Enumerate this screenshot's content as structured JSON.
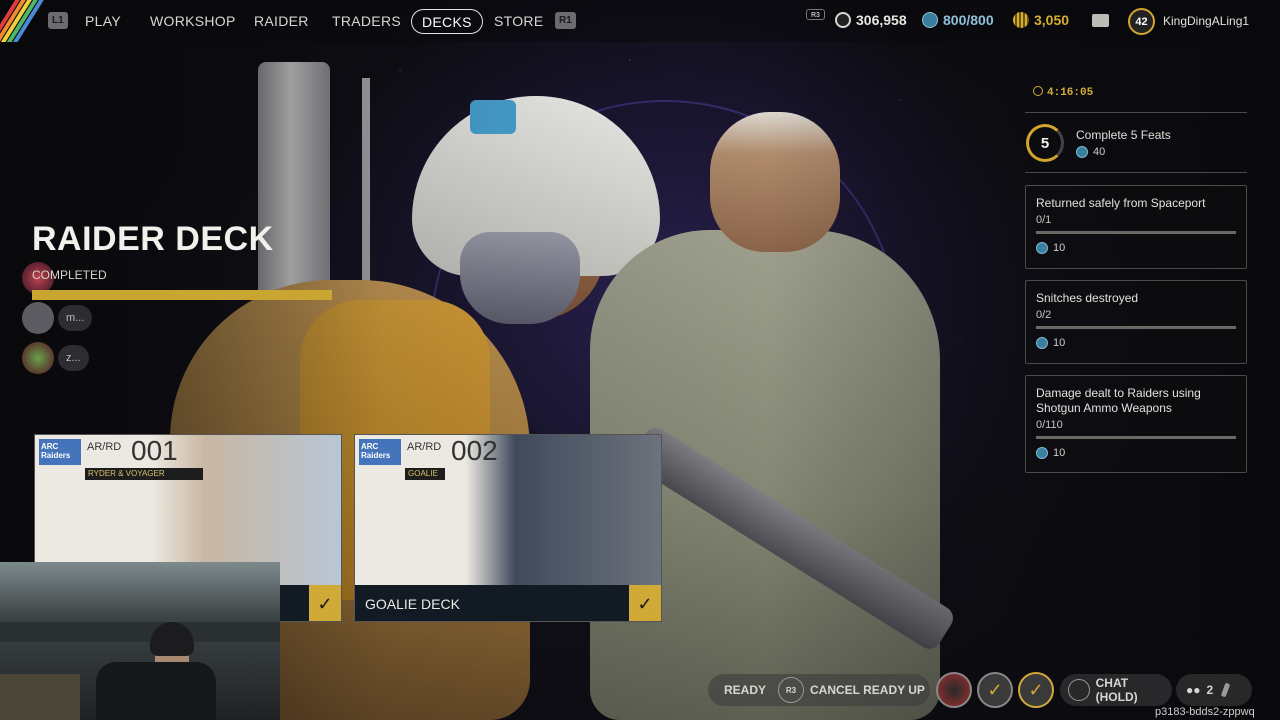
{
  "nav": {
    "left_button": "L1",
    "items": [
      "PLAY",
      "WORKSHOP",
      "RAIDER",
      "TRADERS",
      "DECKS",
      "STORE"
    ],
    "active": "DECKS",
    "right_button": "R1"
  },
  "currencies": {
    "r3_label": "R3",
    "coins": "306,958",
    "credits": "800/800",
    "raider_tokens": "3,050"
  },
  "profile": {
    "level": "42",
    "username": "KingDingALing1"
  },
  "deck": {
    "title": "RAIDER DECK",
    "status": "COMPLETED",
    "progress": 1.0
  },
  "friends": [
    {
      "name": "m..."
    },
    {
      "name": "z..."
    }
  ],
  "cards": [
    {
      "logo": "ARC Raiders",
      "code": "AR/RD",
      "number": "001",
      "subtitle": "RYDER & VOYAGER",
      "label": "",
      "completed": true
    },
    {
      "logo": "ARC Raiders",
      "code": "AR/RD",
      "number": "002",
      "subtitle": "GOALIE",
      "label": "GOALIE DECK",
      "completed": true
    }
  ],
  "feats": {
    "timer": "4:16:05",
    "count": "5",
    "title": "Complete 5 Feats",
    "reward": "40"
  },
  "challenges": [
    {
      "title": "Returned safely from Spaceport",
      "progress": "0/1",
      "reward": "10",
      "fraction": 0
    },
    {
      "title": "Snitches destroyed",
      "progress": "0/2",
      "reward": "10",
      "fraction": 0
    },
    {
      "title": "Damage dealt to Raiders using Shotgun Ammo Weapons",
      "progress": "0/110",
      "reward": "10",
      "fraction": 0
    }
  ],
  "bottom": {
    "ready": "READY",
    "r3": "R3",
    "cancel_ready": "CANCEL READY UP",
    "chat": "CHAT (HOLD)",
    "party_count": "2",
    "session_code": "p3183-bdds2-zppwq"
  },
  "colors": {
    "accent_gold": "#d3a52c",
    "credit_blue": "#3a7fa0",
    "card_footer": "#121a24"
  }
}
